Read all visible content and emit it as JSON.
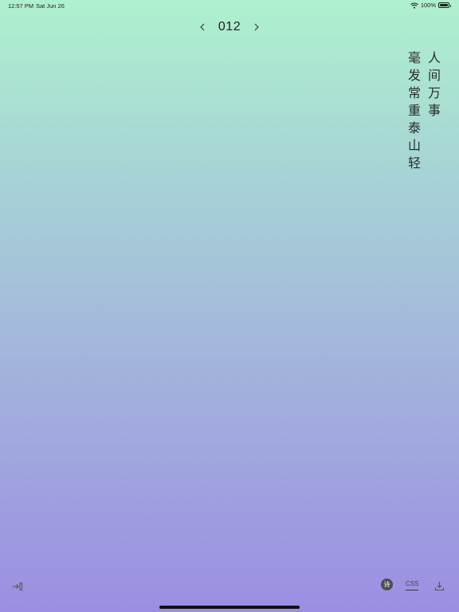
{
  "status_bar": {
    "time": "12:57 PM",
    "date": "Sat Jun 26",
    "battery": "100%",
    "wifi_icon": "wifi-icon",
    "battery_icon": "battery-full-icon"
  },
  "pager": {
    "number": "012",
    "prev_icon": "chevron-left-icon",
    "next_icon": "chevron-right-icon"
  },
  "poem": {
    "lines": [
      "人间万事",
      "毫发常重泰山轻"
    ]
  },
  "bottom_bar": {
    "exit_icon": "exit-icon",
    "poem_badge": "诗",
    "css_tab": "CSS",
    "download_icon": "download-icon"
  },
  "colors": {
    "gradient_top": "#aef1cd",
    "gradient_bottom": "#9b8ee2",
    "text": "#1d1d1f"
  }
}
